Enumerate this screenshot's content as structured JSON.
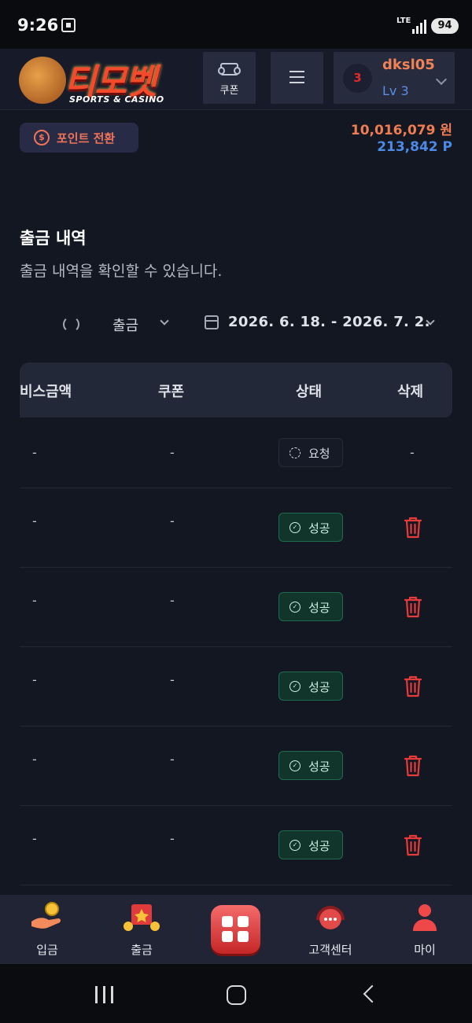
{
  "status_bar": {
    "time": "9:26",
    "network": "LTE",
    "battery": "94"
  },
  "header": {
    "logo_text": "티모벳",
    "logo_sub": "SPORTS & CASINO",
    "coupon_label": "쿠폰",
    "user": {
      "name": "dksl05",
      "level": "Lv 3",
      "avatar_text": "3"
    }
  },
  "wallet": {
    "point_convert_label": "포인트 전환",
    "balance": "10,016,079 원",
    "points": "213,842 P"
  },
  "page": {
    "title": "출금 내역",
    "subtitle": "출금 내역을 확인할 수 있습니다."
  },
  "filters": {
    "type": "출금",
    "date_range": "2026. 6. 18. - 2026. 7. 2."
  },
  "table": {
    "columns": [
      "비스금액",
      "쿠폰",
      "상태",
      "삭제"
    ],
    "rows": [
      {
        "bonus": "-",
        "coupon": "-",
        "status": "요청",
        "delete": "-"
      },
      {
        "bonus": "-",
        "coupon": "-",
        "status": "성공"
      },
      {
        "bonus": "-",
        "coupon": "-",
        "status": "성공"
      },
      {
        "bonus": "-",
        "coupon": "-",
        "status": "성공"
      },
      {
        "bonus": "-",
        "coupon": "-",
        "status": "성공"
      },
      {
        "bonus": "-",
        "coupon": "-",
        "status": "성공"
      }
    ]
  },
  "bottom_nav": [
    "입금",
    "출금",
    "고객센터",
    "마이"
  ],
  "colors": {
    "accent": "#f0735a",
    "points_blue": "#4d8ae5",
    "success": "#1e6b4d",
    "danger": "#e53b3b"
  }
}
